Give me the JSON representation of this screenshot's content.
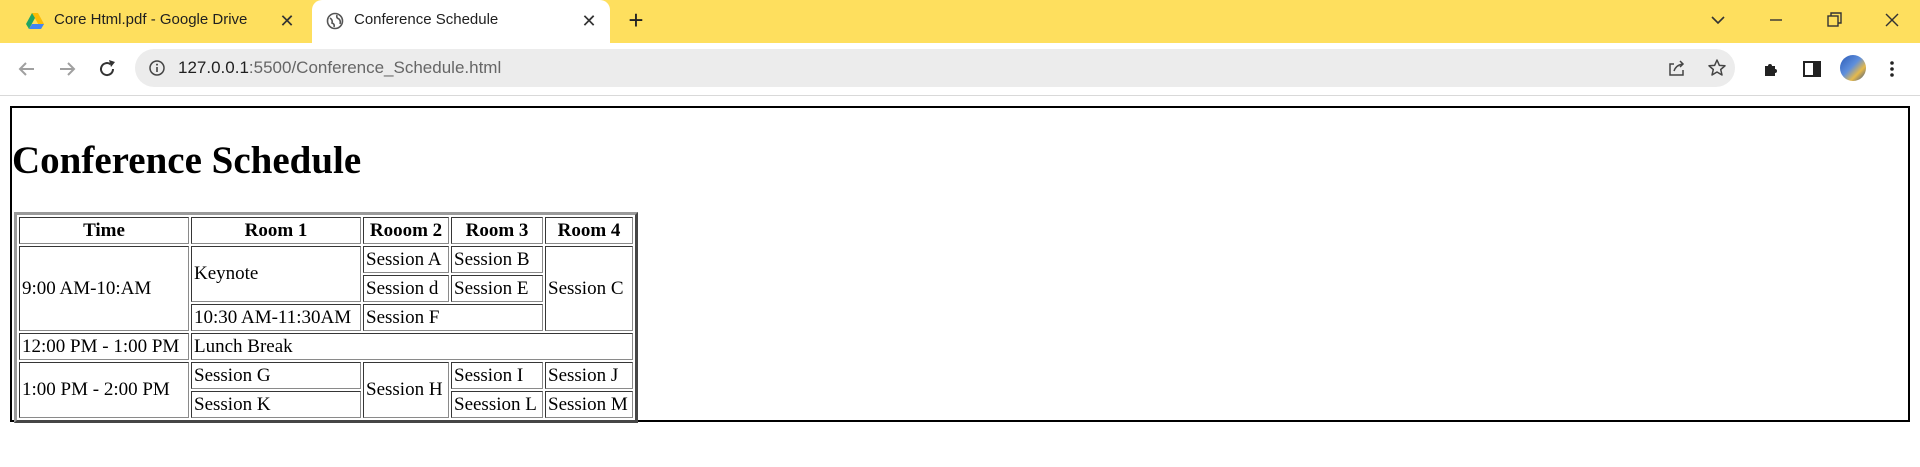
{
  "browser": {
    "tabs": [
      {
        "title": "Core Html.pdf - Google Drive",
        "favicon": "google-drive-icon",
        "active": false
      },
      {
        "title": "Conference Schedule",
        "favicon": "globe-icon",
        "active": true
      }
    ],
    "url_host": "127.0.0.1",
    "url_rest": ":5500/Conference_Schedule.html",
    "colors": {
      "tabstrip": "#fedf5e",
      "omnibox": "#ececec"
    }
  },
  "page": {
    "title": "Conference Schedule",
    "table": {
      "headers": [
        "Time",
        "Room 1",
        "Rooom 2",
        "Room 3",
        "Room 4"
      ],
      "cells": {
        "time_1": "9:00 AM-10:AM",
        "keynote": "Keynote",
        "session_a": "Session A",
        "session_b": "Session B",
        "session_c": "Session C",
        "session_d": "Session d",
        "session_e": "Session E",
        "time_2": "10:30 AM-11:30AM",
        "session_f": "Session F",
        "time_3": "12:00 PM - 1:00 PM",
        "lunch": "Lunch Break",
        "time_4": "1:00 PM - 2:00 PM",
        "session_g": "Session G",
        "session_h": "Session H",
        "session_i": "Session I",
        "session_j": "Session J",
        "session_k": "Session K",
        "session_l": "Seession L",
        "session_m": "Session M"
      }
    }
  }
}
